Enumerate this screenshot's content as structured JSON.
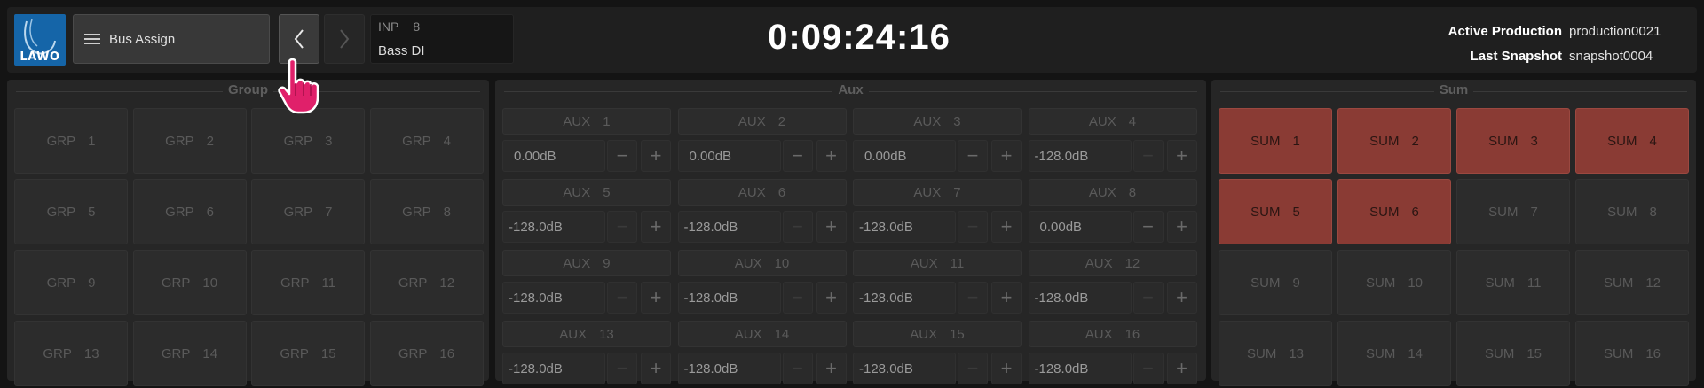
{
  "logo": {
    "text": "LAWO",
    "icon": "lawo-logo"
  },
  "toolbar": {
    "menu_label": "Bus Assign",
    "menu_icon": "hamburger-icon",
    "prev_icon": "chevron-left-icon",
    "next_icon": "chevron-right-icon"
  },
  "channel": {
    "type": "INP",
    "number": "8",
    "name": "Bass DI"
  },
  "clock": "0:09:24:16",
  "production": {
    "active_label": "Active Production",
    "active_value": "production0021",
    "snapshot_label": "Last Snapshot",
    "snapshot_value": "snapshot0004"
  },
  "panels": {
    "group_title": "Group",
    "aux_title": "Aux",
    "sum_title": "Sum"
  },
  "group": {
    "label": "GRP",
    "items": [
      "1",
      "2",
      "3",
      "4",
      "5",
      "6",
      "7",
      "8",
      "9",
      "10",
      "11",
      "12",
      "13",
      "14",
      "15",
      "16"
    ]
  },
  "aux": {
    "label": "AUX",
    "items": [
      {
        "n": "1",
        "value": "0.00dB"
      },
      {
        "n": "2",
        "value": "0.00dB"
      },
      {
        "n": "3",
        "value": "0.00dB"
      },
      {
        "n": "4",
        "value": "-128.0dB"
      },
      {
        "n": "5",
        "value": "-128.0dB"
      },
      {
        "n": "6",
        "value": "-128.0dB"
      },
      {
        "n": "7",
        "value": "-128.0dB"
      },
      {
        "n": "8",
        "value": "0.00dB"
      },
      {
        "n": "9",
        "value": "-128.0dB"
      },
      {
        "n": "10",
        "value": "-128.0dB"
      },
      {
        "n": "11",
        "value": "-128.0dB"
      },
      {
        "n": "12",
        "value": "-128.0dB"
      },
      {
        "n": "13",
        "value": "-128.0dB"
      },
      {
        "n": "14",
        "value": "-128.0dB"
      },
      {
        "n": "15",
        "value": "-128.0dB"
      },
      {
        "n": "16",
        "value": "-128.0dB"
      }
    ],
    "minus": "−",
    "plus": "+"
  },
  "sum": {
    "label": "SUM",
    "items": [
      {
        "n": "1",
        "on": true
      },
      {
        "n": "2",
        "on": true
      },
      {
        "n": "3",
        "on": true
      },
      {
        "n": "4",
        "on": true
      },
      {
        "n": "5",
        "on": true
      },
      {
        "n": "6",
        "on": true
      },
      {
        "n": "7",
        "on": false
      },
      {
        "n": "8",
        "on": false
      },
      {
        "n": "9",
        "on": false
      },
      {
        "n": "10",
        "on": false
      },
      {
        "n": "11",
        "on": false
      },
      {
        "n": "12",
        "on": false
      },
      {
        "n": "13",
        "on": false
      },
      {
        "n": "14",
        "on": false
      },
      {
        "n": "15",
        "on": false
      },
      {
        "n": "16",
        "on": false
      }
    ]
  },
  "colors": {
    "sum_active": "#8a3b34",
    "cursor": "#e0206a"
  },
  "cursor_icon": "hand-pointer-icon"
}
